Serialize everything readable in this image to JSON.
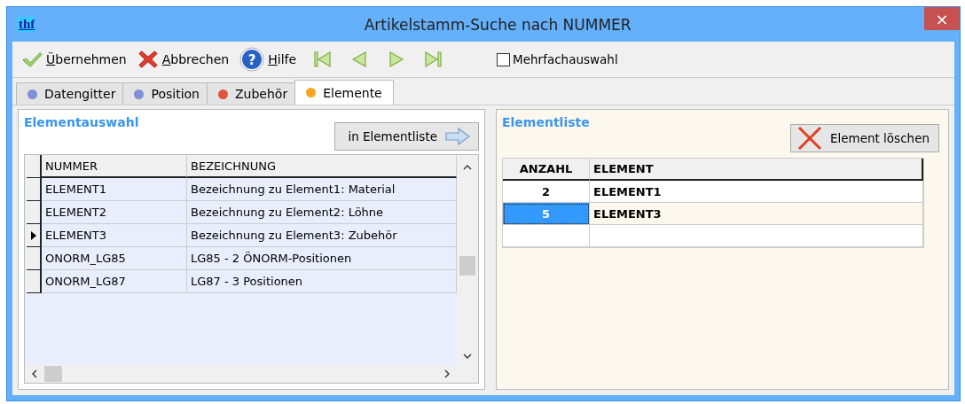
{
  "window": {
    "logo": "thf",
    "title": "Artikelstamm-Suche nach NUMMER",
    "close": "×"
  },
  "toolbar": {
    "buttons": [
      {
        "kind": "ok",
        "label": "Übernehmen"
      },
      {
        "kind": "cancel",
        "label": "Abbrechen"
      },
      {
        "kind": "help",
        "label": "Hilfe",
        "icon": "?"
      },
      {
        "kind": "first"
      },
      {
        "kind": "prev"
      },
      {
        "kind": "next"
      },
      {
        "kind": "last"
      }
    ],
    "multi_select": {
      "label": "Mehrfachauswahl",
      "checked": false
    }
  },
  "tabs": [
    {
      "label": "Datengitter",
      "color": "#7f8fd8",
      "selected": false
    },
    {
      "label": "Position",
      "color": "#7f8fd8",
      "selected": false
    },
    {
      "label": "Zubehör",
      "color": "#e0533e",
      "selected": false
    },
    {
      "label": "Elemente",
      "color": "#f5a623",
      "selected": true
    }
  ],
  "left": {
    "title": "Elementauswahl",
    "button": "in Elementliste",
    "columns": [
      "NUMMER",
      "BEZEICHNUNG"
    ],
    "rows": [
      {
        "cells": [
          "ELEMENT1",
          "Bezeichnung zu Element1: Material"
        ],
        "current": false
      },
      {
        "cells": [
          "ELEMENT2",
          "Bezeichnung zu Element2: Löhne"
        ],
        "current": false
      },
      {
        "cells": [
          "ELEMENT3",
          "Bezeichnung zu Element3: Zubehör"
        ],
        "current": true
      },
      {
        "cells": [
          "ONORM_LG85",
          "LG85 - 2 ÖNORM-Positionen"
        ],
        "current": false
      },
      {
        "cells": [
          "ONORM_LG87",
          "LG87 - 3 Positionen"
        ],
        "current": false
      }
    ]
  },
  "right": {
    "title": "Elementliste",
    "button": "Element löschen",
    "columns": [
      "ANZAHL",
      "ELEMENT"
    ],
    "rows": [
      {
        "cells": [
          "2",
          "ELEMENT1"
        ],
        "selected": false
      },
      {
        "cells": [
          "5",
          "ELEMENT3"
        ],
        "selected": true
      }
    ]
  }
}
